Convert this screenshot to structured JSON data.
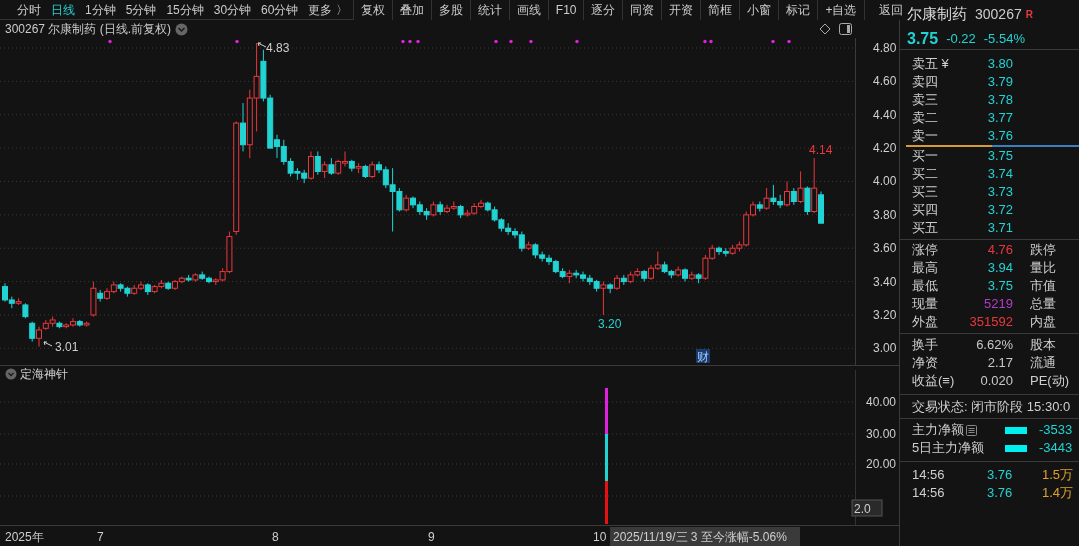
{
  "toolbar": {
    "periods": [
      {
        "label": "分时",
        "selected": false
      },
      {
        "label": "日线",
        "selected": true
      },
      {
        "label": "1分钟",
        "selected": false
      },
      {
        "label": "5分钟",
        "selected": false
      },
      {
        "label": "15分钟",
        "selected": false
      },
      {
        "label": "30分钟",
        "selected": false
      },
      {
        "label": "60分钟",
        "selected": false
      },
      {
        "label": "更多 〉",
        "selected": false
      }
    ],
    "buttons": [
      "复权",
      "叠加",
      "多股",
      "统计",
      "画线",
      "F10",
      "逐分",
      "同资",
      "开资",
      "简框",
      "小窗",
      "标记",
      "+自选",
      "返回"
    ]
  },
  "chart": {
    "title": "300267 尔康制药 (日线.前复权)",
    "chart_data": {
      "type": "candlestick",
      "ylim": [
        2.9,
        4.86
      ],
      "grid": true,
      "yticks": [
        {
          "value": 4.8,
          "label": "4.80"
        },
        {
          "value": 4.6,
          "label": "4.60"
        },
        {
          "value": 4.4,
          "label": "4.40"
        },
        {
          "value": 4.2,
          "label": "4.20"
        },
        {
          "value": 4.0,
          "label": "4.00"
        },
        {
          "value": 3.8,
          "label": "3.80"
        },
        {
          "value": 3.6,
          "label": "3.60"
        },
        {
          "value": 3.4,
          "label": "3.40"
        },
        {
          "value": 3.2,
          "label": "3.20"
        },
        {
          "value": 3.0,
          "label": "3.00"
        }
      ],
      "ohlc": [
        [
          3.37,
          3.39,
          3.28,
          3.29
        ],
        [
          3.29,
          3.31,
          3.24,
          3.27
        ],
        [
          3.27,
          3.3,
          3.26,
          3.28
        ],
        [
          3.26,
          3.27,
          3.18,
          3.19
        ],
        [
          3.15,
          3.16,
          3.04,
          3.06
        ],
        [
          3.06,
          3.13,
          3.01,
          3.11
        ],
        [
          3.12,
          3.17,
          3.11,
          3.15
        ],
        [
          3.15,
          3.19,
          3.13,
          3.17
        ],
        [
          3.15,
          3.16,
          3.12,
          3.13
        ],
        [
          3.13,
          3.15,
          3.12,
          3.14
        ],
        [
          3.14,
          3.18,
          3.13,
          3.16
        ],
        [
          3.16,
          3.17,
          3.13,
          3.14
        ],
        [
          3.14,
          3.16,
          3.13,
          3.15
        ],
        [
          3.2,
          3.4,
          3.19,
          3.36
        ],
        [
          3.33,
          3.35,
          3.28,
          3.3
        ],
        [
          3.3,
          3.36,
          3.29,
          3.34
        ],
        [
          3.34,
          3.4,
          3.33,
          3.38
        ],
        [
          3.38,
          3.39,
          3.34,
          3.36
        ],
        [
          3.36,
          3.37,
          3.31,
          3.33
        ],
        [
          3.33,
          3.38,
          3.32,
          3.36
        ],
        [
          3.36,
          3.4,
          3.35,
          3.38
        ],
        [
          3.38,
          3.39,
          3.32,
          3.34
        ],
        [
          3.34,
          3.38,
          3.33,
          3.37
        ],
        [
          3.37,
          3.41,
          3.36,
          3.39
        ],
        [
          3.39,
          3.4,
          3.35,
          3.36
        ],
        [
          3.36,
          3.41,
          3.35,
          3.4
        ],
        [
          3.4,
          3.43,
          3.39,
          3.42
        ],
        [
          3.42,
          3.44,
          3.4,
          3.41
        ],
        [
          3.41,
          3.45,
          3.4,
          3.44
        ],
        [
          3.44,
          3.46,
          3.41,
          3.42
        ],
        [
          3.42,
          3.43,
          3.39,
          3.4
        ],
        [
          3.4,
          3.42,
          3.38,
          3.41
        ],
        [
          3.41,
          3.48,
          3.4,
          3.46
        ],
        [
          3.46,
          3.7,
          3.45,
          3.67
        ],
        [
          3.7,
          4.36,
          3.68,
          4.35
        ],
        [
          4.35,
          4.47,
          4.18,
          4.22
        ],
        [
          4.22,
          4.55,
          4.14,
          4.5
        ],
        [
          4.5,
          4.83,
          4.3,
          4.63
        ],
        [
          4.72,
          4.79,
          4.48,
          4.5
        ],
        [
          4.5,
          4.52,
          4.2,
          4.2
        ],
        [
          4.25,
          4.28,
          4.14,
          4.21
        ],
        [
          4.21,
          4.25,
          4.1,
          4.12
        ],
        [
          4.12,
          4.14,
          4.03,
          4.05
        ],
        [
          4.06,
          4.08,
          4.01,
          4.05
        ],
        [
          4.05,
          4.07,
          3.99,
          4.02
        ],
        [
          4.02,
          4.18,
          4.01,
          4.15
        ],
        [
          4.15,
          4.18,
          4.04,
          4.06
        ],
        [
          4.06,
          4.12,
          4.02,
          4.1
        ],
        [
          4.1,
          4.14,
          4.04,
          4.05
        ],
        [
          4.05,
          4.13,
          4.04,
          4.12
        ],
        [
          4.11,
          4.18,
          4.09,
          4.12
        ],
        [
          4.12,
          4.13,
          4.06,
          4.08
        ],
        [
          4.08,
          4.11,
          4.05,
          4.09
        ],
        [
          4.09,
          4.1,
          4.02,
          4.03
        ],
        [
          4.03,
          4.12,
          4.02,
          4.1
        ],
        [
          4.1,
          4.12,
          4.05,
          4.07
        ],
        [
          4.07,
          4.09,
          3.96,
          3.98
        ],
        [
          3.98,
          4.08,
          3.7,
          3.94
        ],
        [
          3.94,
          3.96,
          3.82,
          3.83
        ],
        [
          3.83,
          3.92,
          3.82,
          3.9
        ],
        [
          3.9,
          3.91,
          3.84,
          3.86
        ],
        [
          3.86,
          3.88,
          3.8,
          3.82
        ],
        [
          3.82,
          3.84,
          3.77,
          3.8
        ],
        [
          3.8,
          3.88,
          3.79,
          3.86
        ],
        [
          3.86,
          3.88,
          3.8,
          3.82
        ],
        [
          3.82,
          3.86,
          3.81,
          3.84
        ],
        [
          3.84,
          3.88,
          3.83,
          3.85
        ],
        [
          3.85,
          3.86,
          3.78,
          3.8
        ],
        [
          3.8,
          3.83,
          3.79,
          3.81
        ],
        [
          3.81,
          3.87,
          3.8,
          3.85
        ],
        [
          3.85,
          3.89,
          3.84,
          3.87
        ],
        [
          3.87,
          3.88,
          3.82,
          3.83
        ],
        [
          3.83,
          3.85,
          3.76,
          3.77
        ],
        [
          3.77,
          3.78,
          3.7,
          3.72
        ],
        [
          3.72,
          3.75,
          3.68,
          3.7
        ],
        [
          3.7,
          3.72,
          3.66,
          3.68
        ],
        [
          3.68,
          3.7,
          3.58,
          3.6
        ],
        [
          3.6,
          3.64,
          3.59,
          3.62
        ],
        [
          3.62,
          3.63,
          3.54,
          3.56
        ],
        [
          3.56,
          3.58,
          3.52,
          3.54
        ],
        [
          3.54,
          3.56,
          3.5,
          3.52
        ],
        [
          3.52,
          3.53,
          3.45,
          3.46
        ],
        [
          3.46,
          3.48,
          3.42,
          3.43
        ],
        [
          3.43,
          3.47,
          3.39,
          3.45
        ],
        [
          3.45,
          3.47,
          3.42,
          3.44
        ],
        [
          3.44,
          3.46,
          3.4,
          3.42
        ],
        [
          3.42,
          3.44,
          3.38,
          3.4
        ],
        [
          3.4,
          3.41,
          3.34,
          3.36
        ],
        [
          3.36,
          3.4,
          3.2,
          3.38
        ],
        [
          3.38,
          3.39,
          3.33,
          3.36
        ],
        [
          3.36,
          3.44,
          3.35,
          3.42
        ],
        [
          3.42,
          3.44,
          3.38,
          3.4
        ],
        [
          3.4,
          3.46,
          3.39,
          3.44
        ],
        [
          3.44,
          3.48,
          3.43,
          3.46
        ],
        [
          3.46,
          3.47,
          3.4,
          3.42
        ],
        [
          3.42,
          3.5,
          3.41,
          3.48
        ],
        [
          3.48,
          3.58,
          3.47,
          3.5
        ],
        [
          3.5,
          3.52,
          3.45,
          3.46
        ],
        [
          3.46,
          3.47,
          3.42,
          3.44
        ],
        [
          3.44,
          3.49,
          3.43,
          3.47
        ],
        [
          3.47,
          3.48,
          3.4,
          3.42
        ],
        [
          3.42,
          3.46,
          3.41,
          3.44
        ],
        [
          3.44,
          3.45,
          3.39,
          3.42
        ],
        [
          3.42,
          3.56,
          3.41,
          3.54
        ],
        [
          3.54,
          3.62,
          3.53,
          3.6
        ],
        [
          3.6,
          3.61,
          3.56,
          3.58
        ],
        [
          3.58,
          3.6,
          3.55,
          3.57
        ],
        [
          3.57,
          3.62,
          3.56,
          3.6
        ],
        [
          3.6,
          3.64,
          3.58,
          3.62
        ],
        [
          3.62,
          3.82,
          3.61,
          3.8
        ],
        [
          3.8,
          3.88,
          3.79,
          3.86
        ],
        [
          3.86,
          3.88,
          3.82,
          3.84
        ],
        [
          3.84,
          3.96,
          3.83,
          3.9
        ],
        [
          3.9,
          3.98,
          3.86,
          3.88
        ],
        [
          3.88,
          3.92,
          3.84,
          3.86
        ],
        [
          3.86,
          4.0,
          3.85,
          3.94
        ],
        [
          3.94,
          3.96,
          3.86,
          3.88
        ],
        [
          3.88,
          4.06,
          3.87,
          3.96
        ],
        [
          3.96,
          3.97,
          3.8,
          3.82
        ],
        [
          3.82,
          4.14,
          3.81,
          3.96
        ],
        [
          3.92,
          3.94,
          3.75,
          3.75
        ]
      ]
    },
    "annotations": [
      {
        "text": "4.83",
        "kind": "high"
      },
      {
        "text": "3.01",
        "kind": "low"
      },
      {
        "text": "4.14",
        "kind": "recent_high"
      },
      {
        "text": "3.20",
        "kind": "recent_low"
      }
    ],
    "marker": "财"
  },
  "indicator": {
    "title": "定海神针",
    "y_ticks": [
      "40.00",
      "30.00",
      "20.00"
    ],
    "cursor_value": "2.0"
  },
  "x_axis": {
    "labels": [
      "2025年",
      "7",
      "8",
      "9",
      "10"
    ],
    "cursor_info": "2025/11/19/三 3 至今涨幅-5.06%"
  },
  "quote": {
    "name": "尔康制药",
    "code": "300267",
    "badge": "R",
    "price": "3.75",
    "change": "-0.22",
    "change_pct": "-5.54%"
  },
  "order_book": {
    "asks": [
      {
        "label": "卖五 ¥",
        "price": "3.80"
      },
      {
        "label": "卖四",
        "price": "3.79"
      },
      {
        "label": "卖三",
        "price": "3.78"
      },
      {
        "label": "卖二",
        "price": "3.77"
      },
      {
        "label": "卖一",
        "price": "3.76"
      }
    ],
    "bids": [
      {
        "label": "买一",
        "price": "3.75"
      },
      {
        "label": "买二",
        "price": "3.74"
      },
      {
        "label": "买三",
        "price": "3.73"
      },
      {
        "label": "买四",
        "price": "3.72"
      },
      {
        "label": "买五",
        "price": "3.71"
      }
    ]
  },
  "stats": [
    {
      "label": "涨停",
      "value": "4.76",
      "color": "#e8383d",
      "label_2": "跌停"
    },
    {
      "label": "最高",
      "value": "3.94",
      "color": "#22d3d3",
      "label_2": "量比"
    },
    {
      "label": "最低",
      "value": "3.75",
      "color": "#22d3d3",
      "label_2": "市值"
    },
    {
      "label": "现量",
      "value": "5219",
      "color": "#b03cc8",
      "label_2": "总量"
    },
    {
      "label": "外盘",
      "value": "351592",
      "color": "#e8383d",
      "label_2": "内盘"
    }
  ],
  "fundamentals": [
    {
      "label": "换手",
      "value": "6.62%",
      "label_2": "股本"
    },
    {
      "label": "净资",
      "value": "2.17",
      "label_2": "流通"
    },
    {
      "label": "收益(≡)",
      "value": "0.020",
      "label_2": "PE(动)"
    }
  ],
  "trade_status": "交易状态: 闭市阶段 15:30:0",
  "fund_flow": [
    {
      "label": "主力净额",
      "has_menu": true,
      "value": "-3533"
    },
    {
      "label": "5日主力净额",
      "has_menu": false,
      "value": "-3443"
    }
  ],
  "ticks": [
    {
      "time": "14:56",
      "price": "3.76",
      "volume": "1.5万"
    },
    {
      "time": "14:56",
      "price": "3.76",
      "volume": "1.4万"
    }
  ]
}
